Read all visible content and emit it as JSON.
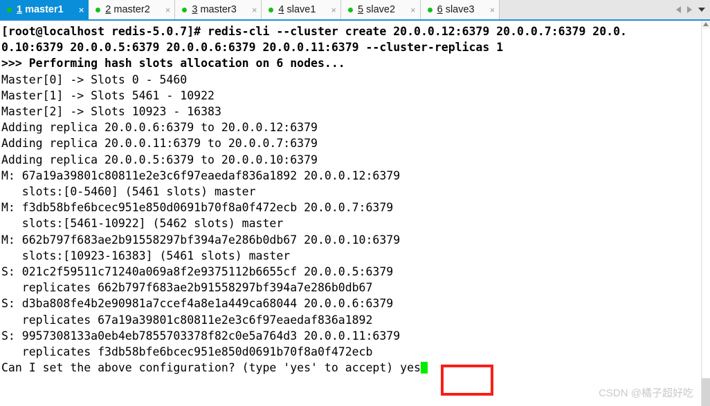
{
  "tabbar": {
    "tabs": [
      {
        "num": "1",
        "label": "master1",
        "active": true,
        "close": "×",
        "dot": "status-dot"
      },
      {
        "num": "2",
        "label": "master2",
        "active": false,
        "close": "×",
        "dot": "status-dot"
      },
      {
        "num": "3",
        "label": "master3",
        "active": false,
        "close": "×",
        "dot": "status-dot"
      },
      {
        "num": "4",
        "label": "slave1",
        "active": false,
        "close": "×",
        "dot": "status-dot"
      },
      {
        "num": "5",
        "label": "slave2",
        "active": false,
        "close": "×",
        "dot": "status-dot"
      },
      {
        "num": "6",
        "label": "slave3",
        "active": false,
        "close": "×",
        "dot": "status-dot"
      }
    ],
    "nav": {
      "prev_icon": "chevron-left-icon",
      "next_icon": "chevron-right-icon",
      "list_icon": "chevron-down-icon"
    },
    "colors": {
      "active_tab_bg": "#0a8ed9",
      "inactive_tab_bg": "#fafafa",
      "bar_bg": "#e6e6e6",
      "underline": "#1f8fd6",
      "status_dot": "#14c014"
    }
  },
  "terminal": {
    "lines": [
      {
        "text": "[root@localhost redis-5.0.7]# redis-cli --cluster create 20.0.0.12:6379 20.0.0.7:6379 20.0.",
        "bold": true
      },
      {
        "text": "0.10:6379 20.0.0.5:6379 20.0.0.6:6379 20.0.0.11:6379 --cluster-replicas 1",
        "bold": true
      },
      {
        "text": ">>> Performing hash slots allocation on 6 nodes...",
        "bold": true
      },
      {
        "text": "Master[0] -> Slots 0 - 5460",
        "bold": false
      },
      {
        "text": "Master[1] -> Slots 5461 - 10922",
        "bold": false
      },
      {
        "text": "Master[2] -> Slots 10923 - 16383",
        "bold": false
      },
      {
        "text": "Adding replica 20.0.0.6:6379 to 20.0.0.12:6379",
        "bold": false
      },
      {
        "text": "Adding replica 20.0.0.11:6379 to 20.0.0.7:6379",
        "bold": false
      },
      {
        "text": "Adding replica 20.0.0.5:6379 to 20.0.0.10:6379",
        "bold": false
      },
      {
        "text": "M: 67a19a39801c80811e2e3c6f97eaedaf836a1892 20.0.0.12:6379",
        "bold": false
      },
      {
        "text": "   slots:[0-5460] (5461 slots) master",
        "bold": false
      },
      {
        "text": "M: f3db58bfe6bcec951e850d0691b70f8a0f472ecb 20.0.0.7:6379",
        "bold": false
      },
      {
        "text": "   slots:[5461-10922] (5462 slots) master",
        "bold": false
      },
      {
        "text": "M: 662b797f683ae2b91558297bf394a7e286b0db67 20.0.0.10:6379",
        "bold": false
      },
      {
        "text": "   slots:[10923-16383] (5461 slots) master",
        "bold": false
      },
      {
        "text": "S: 021c2f59511c71240a069a8f2e9375112b6655cf 20.0.0.5:6379",
        "bold": false
      },
      {
        "text": "   replicates 662b797f683ae2b91558297bf394a7e286b0db67",
        "bold": false
      },
      {
        "text": "S: d3ba808fe4b2e90981a7ccef4a8e1a449ca68044 20.0.0.6:6379",
        "bold": false
      },
      {
        "text": "   replicates 67a19a39801c80811e2e3c6f97eaedaf836a1892",
        "bold": false
      },
      {
        "text": "S: 9957308133a0eb4eb7855703378f82c0e5a764d3 20.0.0.11:6379",
        "bold": false
      },
      {
        "text": "   replicates f3db58bfe6bcec951e850d0691b70f8a0f472ecb",
        "bold": false
      }
    ],
    "prompt": {
      "question": "Can I set the above configuration? (type 'yes' to accept) ",
      "typed_answer": "yes",
      "cursor_color": "#00ee00"
    }
  },
  "annotation": {
    "highlight_color": "#f81f16",
    "target": "typed-answer-yes"
  },
  "watermark": {
    "text": "CSDN @橘子超好吃"
  },
  "scrollbar": {
    "up_icon": "scroll-up-arrow-icon"
  }
}
